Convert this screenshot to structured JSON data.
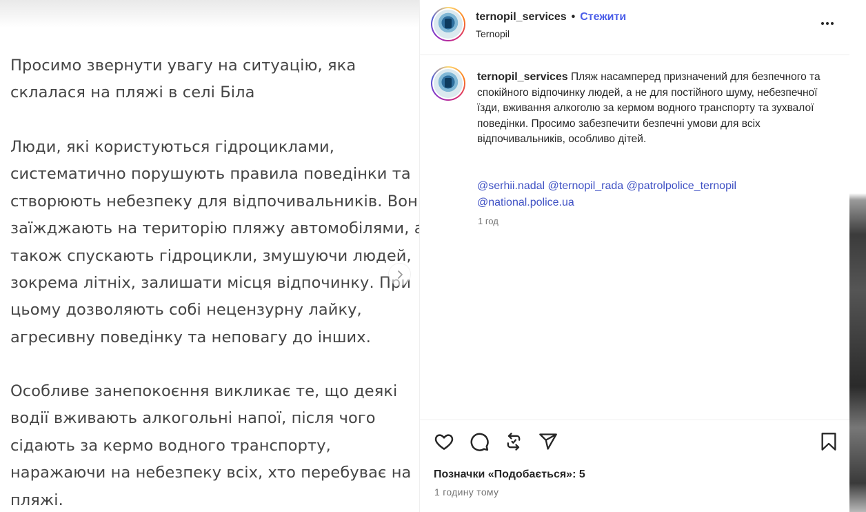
{
  "media": {
    "paragraphs": [
      [
        "Просимо звернути увагу на ситуацію, яка",
        "склалася на пляжі в селі Біла"
      ],
      [
        "Люди, які користуються гідроциклами,",
        "систематично порушують правила поведінки та",
        "створюють небезпеку для відпочивальників. Вони",
        "заїжджають на територію пляжу автомобілями, а",
        "також спускають гідроцикли, змушуючи людей,",
        "зокрема літніх, залишати місця відпочинку. При",
        "цьому дозволяють собі нецензурну лайку,",
        "агресивну поведінку та неповагу до інших."
      ],
      [
        "Особливе занепокоєння викликає те, що деякі",
        "водії вживають алкогольні напої, після чого",
        "сідають за кермо водного транспорту,",
        "наражаючи на небезпеку всіх, хто перебуває на",
        "пляжі."
      ]
    ],
    "next_icon": "chevron-right-icon"
  },
  "header": {
    "username": "ternopil_services",
    "separator": "•",
    "follow_label": "Стежити",
    "location": "Ternopil",
    "more_icon": "more-horizontal-icon"
  },
  "caption": {
    "username": "ternopil_services",
    "text": "Пляж насамперед призначений для безпечного та спокійного відпочинку людей, а не для постійного шуму, небезпечної їзди, вживання алкоголю за кермом водного транспорту та зухвалої поведінки. Просимо забезпечити безпечні умови для всіх відпочивальників, особливо дітей.",
    "tags": [
      "@serhii.nadal",
      "@ternopil_rada",
      "@patrolpolice_ternopil",
      "@national.police.ua"
    ],
    "time": "1 год"
  },
  "actions": {
    "icons": [
      "heart-icon",
      "comment-icon",
      "repost-icon",
      "share-icon",
      "bookmark-icon"
    ],
    "likes_text": "Позначки «Подобається»: 5",
    "timestamp": "1 годину тому"
  },
  "colors": {
    "link": "#4a5de8",
    "text": "#262626",
    "muted": "#737373",
    "media_text": "#454545"
  }
}
